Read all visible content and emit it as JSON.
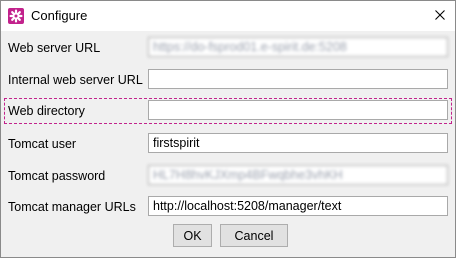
{
  "window": {
    "title": "Configure",
    "accent": "#c2228c"
  },
  "form": {
    "fields": [
      {
        "label": "Web server URL",
        "value": "https://do-fsprod01.e-spirit.de:5208",
        "obscured": true
      },
      {
        "label": "Internal web server URL",
        "value": "",
        "obscured": false
      },
      {
        "label": "Web directory",
        "value": "",
        "obscured": false,
        "focused": true
      },
      {
        "label": "Tomcat user",
        "value": "firstspirit",
        "obscured": false
      },
      {
        "label": "Tomcat password",
        "value": "HL7H8hvKJXmp4BFwqbhe3vhKH",
        "obscured": true
      },
      {
        "label": "Tomcat manager URLs",
        "value": "http://localhost:5208/manager/text",
        "obscured": false
      }
    ]
  },
  "buttons": {
    "ok": "OK",
    "cancel": "Cancel"
  },
  "icons": {
    "app": "gear-icon",
    "close": "close-icon"
  }
}
